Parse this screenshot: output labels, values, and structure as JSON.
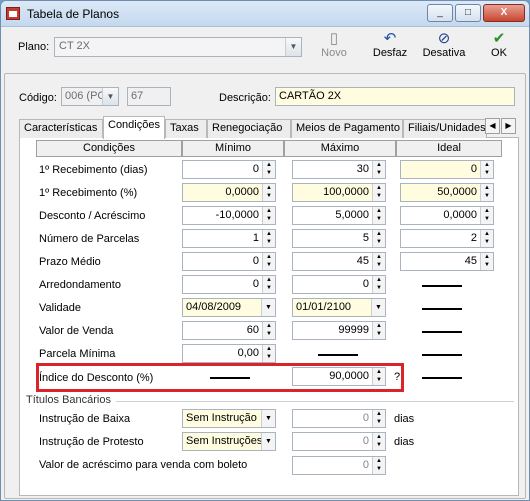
{
  "window": {
    "title": "Tabela de Planos",
    "minimize": "_",
    "maximize": "□",
    "close": "X"
  },
  "toolbar": {
    "plano_label": "Plano:",
    "plano_value": "CT   2X",
    "novo": "Novo",
    "desfaz": "Desfaz",
    "desativa": "Desativa",
    "ok": "OK"
  },
  "header": {
    "codigo_label": "Código:",
    "codigo_value": "006 (PC",
    "codigo_num": "67",
    "descricao_label": "Descrição:",
    "descricao_value": "CARTÃO 2X"
  },
  "tabs": [
    "Características",
    "Condições",
    "Taxas",
    "Renegociação",
    "Meios de Pagamento",
    "Filiais/Unidades"
  ],
  "grid": {
    "headers": [
      "Condições",
      "Mínimo",
      "Máximo",
      "Ideal"
    ],
    "rows": [
      {
        "label": "1º Recebimento (dias)",
        "min": "0",
        "max": "30",
        "ideal": "0"
      },
      {
        "label": "1º Recebimento (%)",
        "min": "0,0000",
        "max": "100,0000",
        "ideal": "50,0000"
      },
      {
        "label": "Desconto / Acréscimo",
        "min": "-10,0000",
        "max": "5,0000",
        "ideal": "0,0000"
      },
      {
        "label": "Número de Parcelas",
        "min": "1",
        "max": "5",
        "ideal": "2"
      },
      {
        "label": "Prazo Médio",
        "min": "0",
        "max": "45",
        "ideal": "45"
      },
      {
        "label": "Arredondamento",
        "min": "0",
        "max": "0",
        "ideal": ""
      },
      {
        "label": "Validade",
        "min": "04/08/2009",
        "max": "01/01/2100",
        "ideal": ""
      },
      {
        "label": "Valor de Venda",
        "min": "60",
        "max": "99999",
        "ideal": ""
      },
      {
        "label": "Parcela Mínima",
        "min": "0,00",
        "max": "",
        "ideal": ""
      },
      {
        "label": "Índice do Desconto (%)",
        "min": "",
        "max": "90,0000",
        "ideal": ""
      }
    ],
    "question_mark": "?"
  },
  "titulos": {
    "group_label": "Títulos Bancários",
    "baixa_label": "Instrução de Baixa",
    "baixa_value": "Sem Instrução",
    "baixa_num": "0",
    "protesto_label": "Instrução de Protesto",
    "protesto_value": "Sem Instruções",
    "protesto_num": "0",
    "dias": "dias",
    "acrescimo_label": "Valor de acréscimo para venda com boleto",
    "acrescimo_value": "0"
  },
  "colors": {
    "yellow_field": "#fffce0",
    "red_highlight": "#d9242a",
    "title_bar": "#c4d8ee"
  }
}
